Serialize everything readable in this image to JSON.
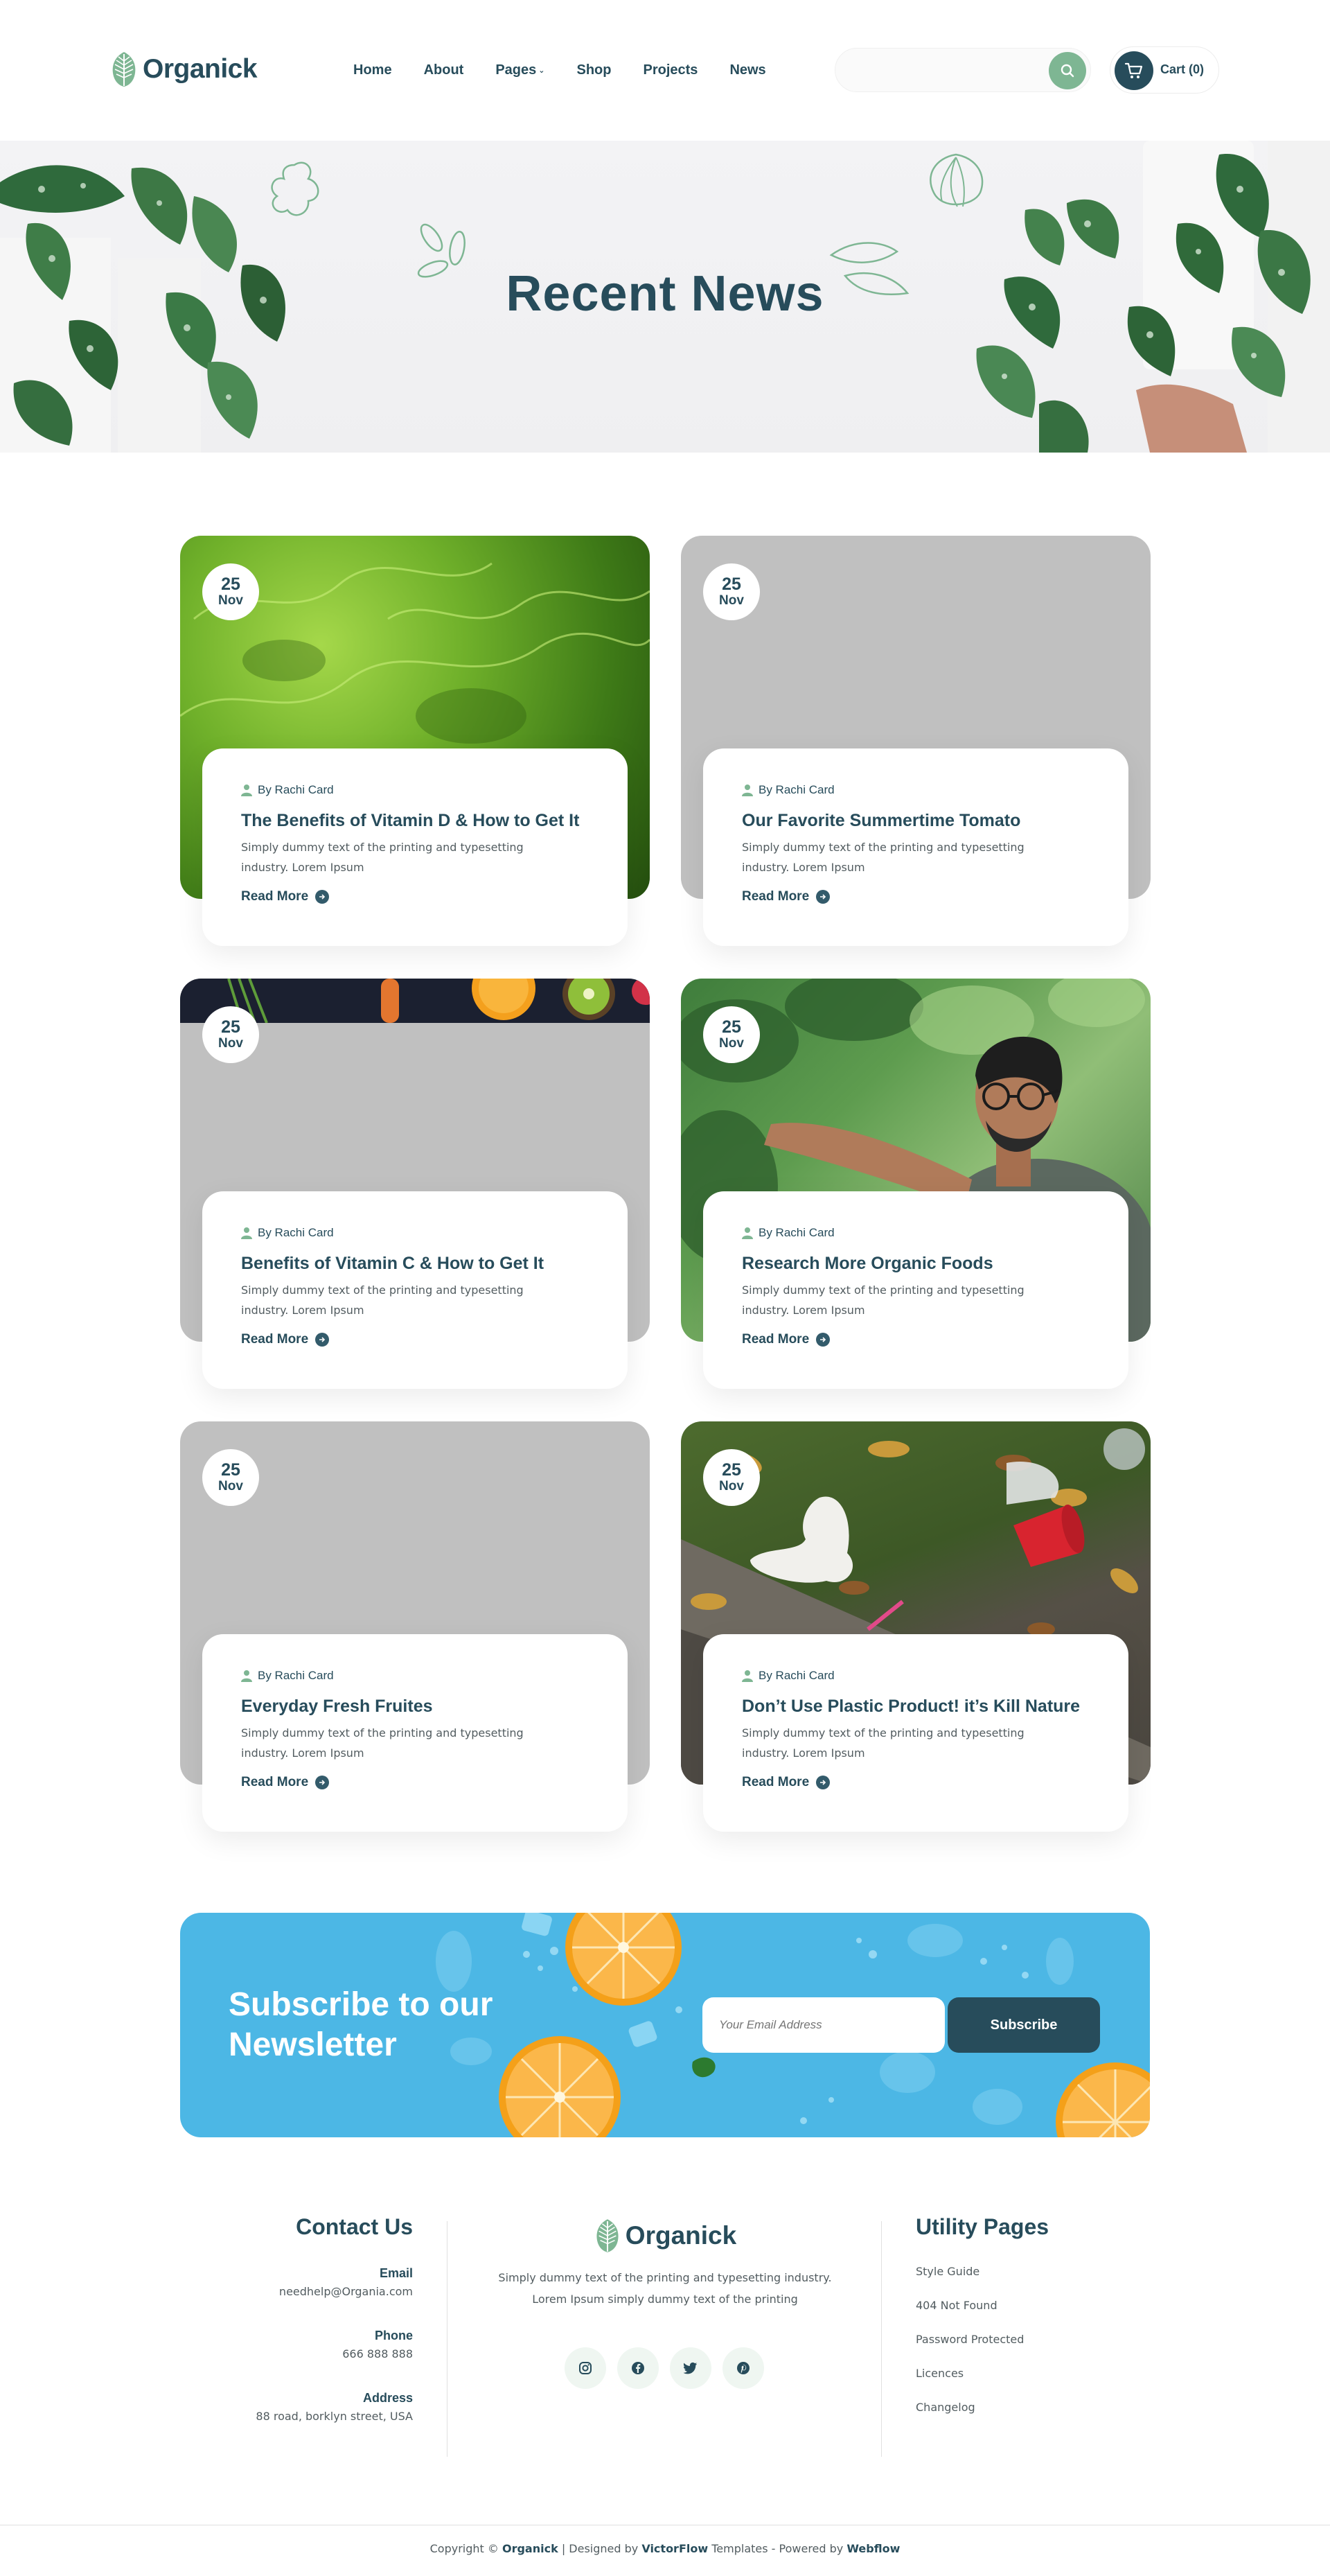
{
  "brand": {
    "name": "Organick",
    "accent": "#7eb693",
    "dark": "#274c5b"
  },
  "nav": {
    "items": [
      {
        "label": "Home"
      },
      {
        "label": "About"
      },
      {
        "label": "Pages",
        "caret": "⌄"
      },
      {
        "label": "Shop"
      },
      {
        "label": "Projects"
      },
      {
        "label": "News"
      }
    ]
  },
  "search": {
    "placeholder": "",
    "value": ""
  },
  "cart": {
    "label": "Cart (0)"
  },
  "hero": {
    "title": "Recent  News"
  },
  "posts": [
    {
      "day": "25",
      "month": "Nov",
      "author": "By Rachi Card",
      "title": "The Benefits of Vitamin D & How to Get It",
      "excerpt": "Simply dummy text of the printing and typesetting industry. Lorem Ipsum",
      "cta": "Read More",
      "image": "lettuce"
    },
    {
      "day": "25",
      "month": "Nov",
      "author": "By Rachi Card",
      "title": "Our Favorite Summertime Tomato",
      "excerpt": "Simply dummy text of the printing and typesetting industry. Lorem Ipsum",
      "cta": "Read More",
      "image": "placeholder"
    },
    {
      "day": "25",
      "month": "Nov",
      "author": "By Rachi Card",
      "title": "Benefits of Vitamin C & How to Get It",
      "excerpt": "Simply dummy text of the printing and typesetting industry. Lorem Ipsum",
      "cta": "Read More",
      "image": "fruits-strip"
    },
    {
      "day": "25",
      "month": "Nov",
      "author": "By Rachi Card",
      "title": "Research More Organic Foods",
      "excerpt": "Simply dummy text of the printing and typesetting industry. Lorem Ipsum",
      "cta": "Read More",
      "image": "man-in-garden"
    },
    {
      "day": "25",
      "month": "Nov",
      "author": "By Rachi Card",
      "title": "Everyday Fresh Fruites",
      "excerpt": "Simply dummy text of the printing and typesetting industry. Lorem Ipsum",
      "cta": "Read More",
      "image": "placeholder"
    },
    {
      "day": "25",
      "month": "Nov",
      "author": "By Rachi Card",
      "title": "Don’t Use Plastic Product! it’s Kill Nature",
      "excerpt": "Simply dummy text of the printing and typesetting industry. Lorem Ipsum",
      "cta": "Read More",
      "image": "litter"
    }
  ],
  "newsletter": {
    "title": "Subscribe to our Newsletter",
    "placeholder": "Your Email Address",
    "button": "Subscribe"
  },
  "footer": {
    "contact": {
      "heading": "Contact Us",
      "items": [
        {
          "label": "Email",
          "value": "needhelp@Organia.com"
        },
        {
          "label": "Phone",
          "value": "666 888 888"
        },
        {
          "label": "Address",
          "value": "88 road, borklyn street, USA"
        }
      ]
    },
    "about": {
      "name": "Organick",
      "text_line1": "Simply dummy text of the printing and typesetting industry.",
      "text_line2": "Lorem Ipsum simply dummy text of the printing",
      "socials": [
        "instagram-icon",
        "facebook-icon",
        "twitter-icon",
        "pinterest-icon"
      ]
    },
    "utility": {
      "heading": "Utility Pages",
      "links": [
        "Style Guide",
        "404 Not Found",
        "Password Protected",
        "Licences",
        "Changelog"
      ]
    },
    "copyright": {
      "prefix": "Copyright © ",
      "brand": "Organick",
      "mid": " | Designed by ",
      "designer": "VictorFlow",
      "mid2": " Templates - Powered by ",
      "platform": "Webflow"
    }
  }
}
